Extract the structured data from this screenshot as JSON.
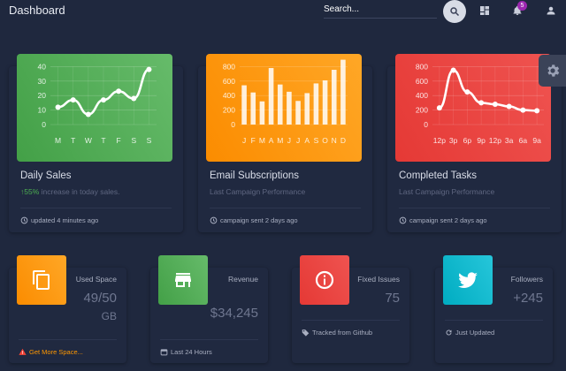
{
  "header": {
    "title": "Dashboard",
    "search_placeholder": "Search...",
    "notification_count": "5"
  },
  "colors": {
    "background": "#1f283e",
    "card": "#202940",
    "green": "#4caf50",
    "orange": "#ff9800",
    "red": "#e53935",
    "cyan": "#00bcd4"
  },
  "cards": [
    {
      "title": "Daily Sales",
      "subtitle_highlight": "55%",
      "subtitle_rest": " increase in today sales.",
      "footer": "updated 4 minutes ago"
    },
    {
      "title": "Email Subscriptions",
      "subtitle": "Last Campaign Performance",
      "footer": "campaign sent 2 days ago"
    },
    {
      "title": "Completed Tasks",
      "subtitle": "Last Campaign Performance",
      "footer": "campaign sent 2 days ago"
    }
  ],
  "chart_data": [
    {
      "type": "line",
      "categories": [
        "M",
        "T",
        "W",
        "T",
        "F",
        "S",
        "S"
      ],
      "values": [
        12,
        17,
        7,
        17,
        23,
        18,
        38
      ],
      "ylim": [
        0,
        50
      ],
      "yticks": [
        "0",
        "10",
        "20",
        "30",
        "40"
      ],
      "grid": true
    },
    {
      "type": "bar",
      "categories": [
        "J",
        "F",
        "M",
        "A",
        "M",
        "J",
        "J",
        "A",
        "S",
        "O",
        "N",
        "D"
      ],
      "values": [
        542,
        443,
        320,
        780,
        553,
        453,
        326,
        434,
        568,
        610,
        756,
        895
      ],
      "ylim": [
        0,
        1000
      ],
      "yticks": [
        "0",
        "200",
        "400",
        "600",
        "800"
      ],
      "grid": true
    },
    {
      "type": "line",
      "categories": [
        "12p",
        "3p",
        "6p",
        "9p",
        "12p",
        "3a",
        "6a",
        "9a"
      ],
      "values": [
        230,
        750,
        450,
        300,
        280,
        250,
        200,
        190
      ],
      "ylim": [
        0,
        1000
      ],
      "yticks": [
        "0",
        "200",
        "400",
        "600",
        "800"
      ],
      "grid": true
    }
  ],
  "stats": [
    {
      "label": "Used Space",
      "value": "49/50",
      "unit": "GB",
      "footer": "Get More Space...",
      "icon": "content-copy-icon"
    },
    {
      "label": "Revenue",
      "value": "$34,245",
      "footer": "Last 24 Hours",
      "icon": "store-icon"
    },
    {
      "label": "Fixed Issues",
      "value": "75",
      "footer": "Tracked from Github",
      "icon": "info-icon"
    },
    {
      "label": "Followers",
      "value": "+245",
      "footer": "Just Updated",
      "icon": "twitter-icon"
    }
  ]
}
